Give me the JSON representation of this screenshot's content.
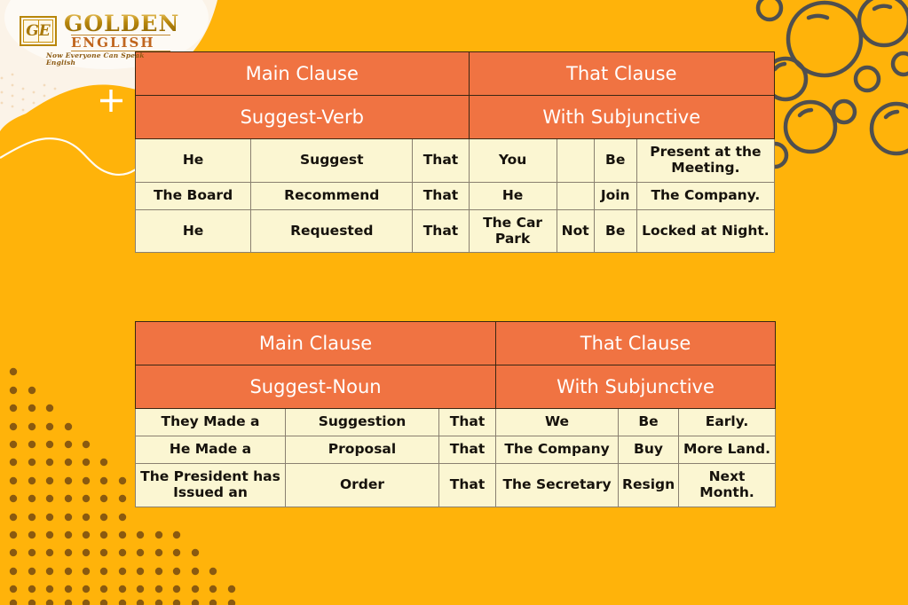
{
  "brand": {
    "monogram": "GE",
    "name_top": "GOLDEN",
    "name_bottom": "ENGLISH",
    "tagline": "Now Everyone Can Speak English"
  },
  "colors": {
    "background": "#FFB30A",
    "header_orange": "#F07342",
    "cell_cream": "#FBF6D2",
    "border": "#8A8070",
    "dot_brown": "#8A5A10",
    "bubble_outline": "#4F4F4F",
    "text_dark": "#16120C",
    "header_text": "#FFFFFF"
  },
  "tables": [
    {
      "id": "suggest-verb-table",
      "group_headers": [
        "Main Clause",
        "That Clause"
      ],
      "sub_headers": [
        "Suggest-Verb",
        "With Subjunctive"
      ],
      "rows": [
        [
          "He",
          "Suggest",
          "That",
          "You",
          "",
          "Be",
          "Present at the Meeting."
        ],
        [
          "The Board",
          "Recommend",
          "That",
          "He",
          "",
          "Join",
          "The Company."
        ],
        [
          "He",
          "Requested",
          "That",
          "The Car Park",
          "Not",
          "Be",
          "Locked at Night."
        ]
      ]
    },
    {
      "id": "suggest-noun-table",
      "group_headers": [
        "Main Clause",
        "That Clause"
      ],
      "sub_headers": [
        "Suggest-Noun",
        "With Subjunctive"
      ],
      "rows": [
        [
          "They Made a",
          "Suggestion",
          "That",
          "We",
          "Be",
          "Early."
        ],
        [
          "He Made a",
          "Proposal",
          "That",
          "The Company",
          "Buy",
          "More Land."
        ],
        [
          "The President has Issued an",
          "Order",
          "That",
          "The Secretary",
          "Resign",
          "Next Month."
        ]
      ]
    }
  ],
  "decorations": {
    "plus_glyph": "+",
    "bubble_count": 12,
    "dot_pattern": "triangular-dot-grid"
  }
}
